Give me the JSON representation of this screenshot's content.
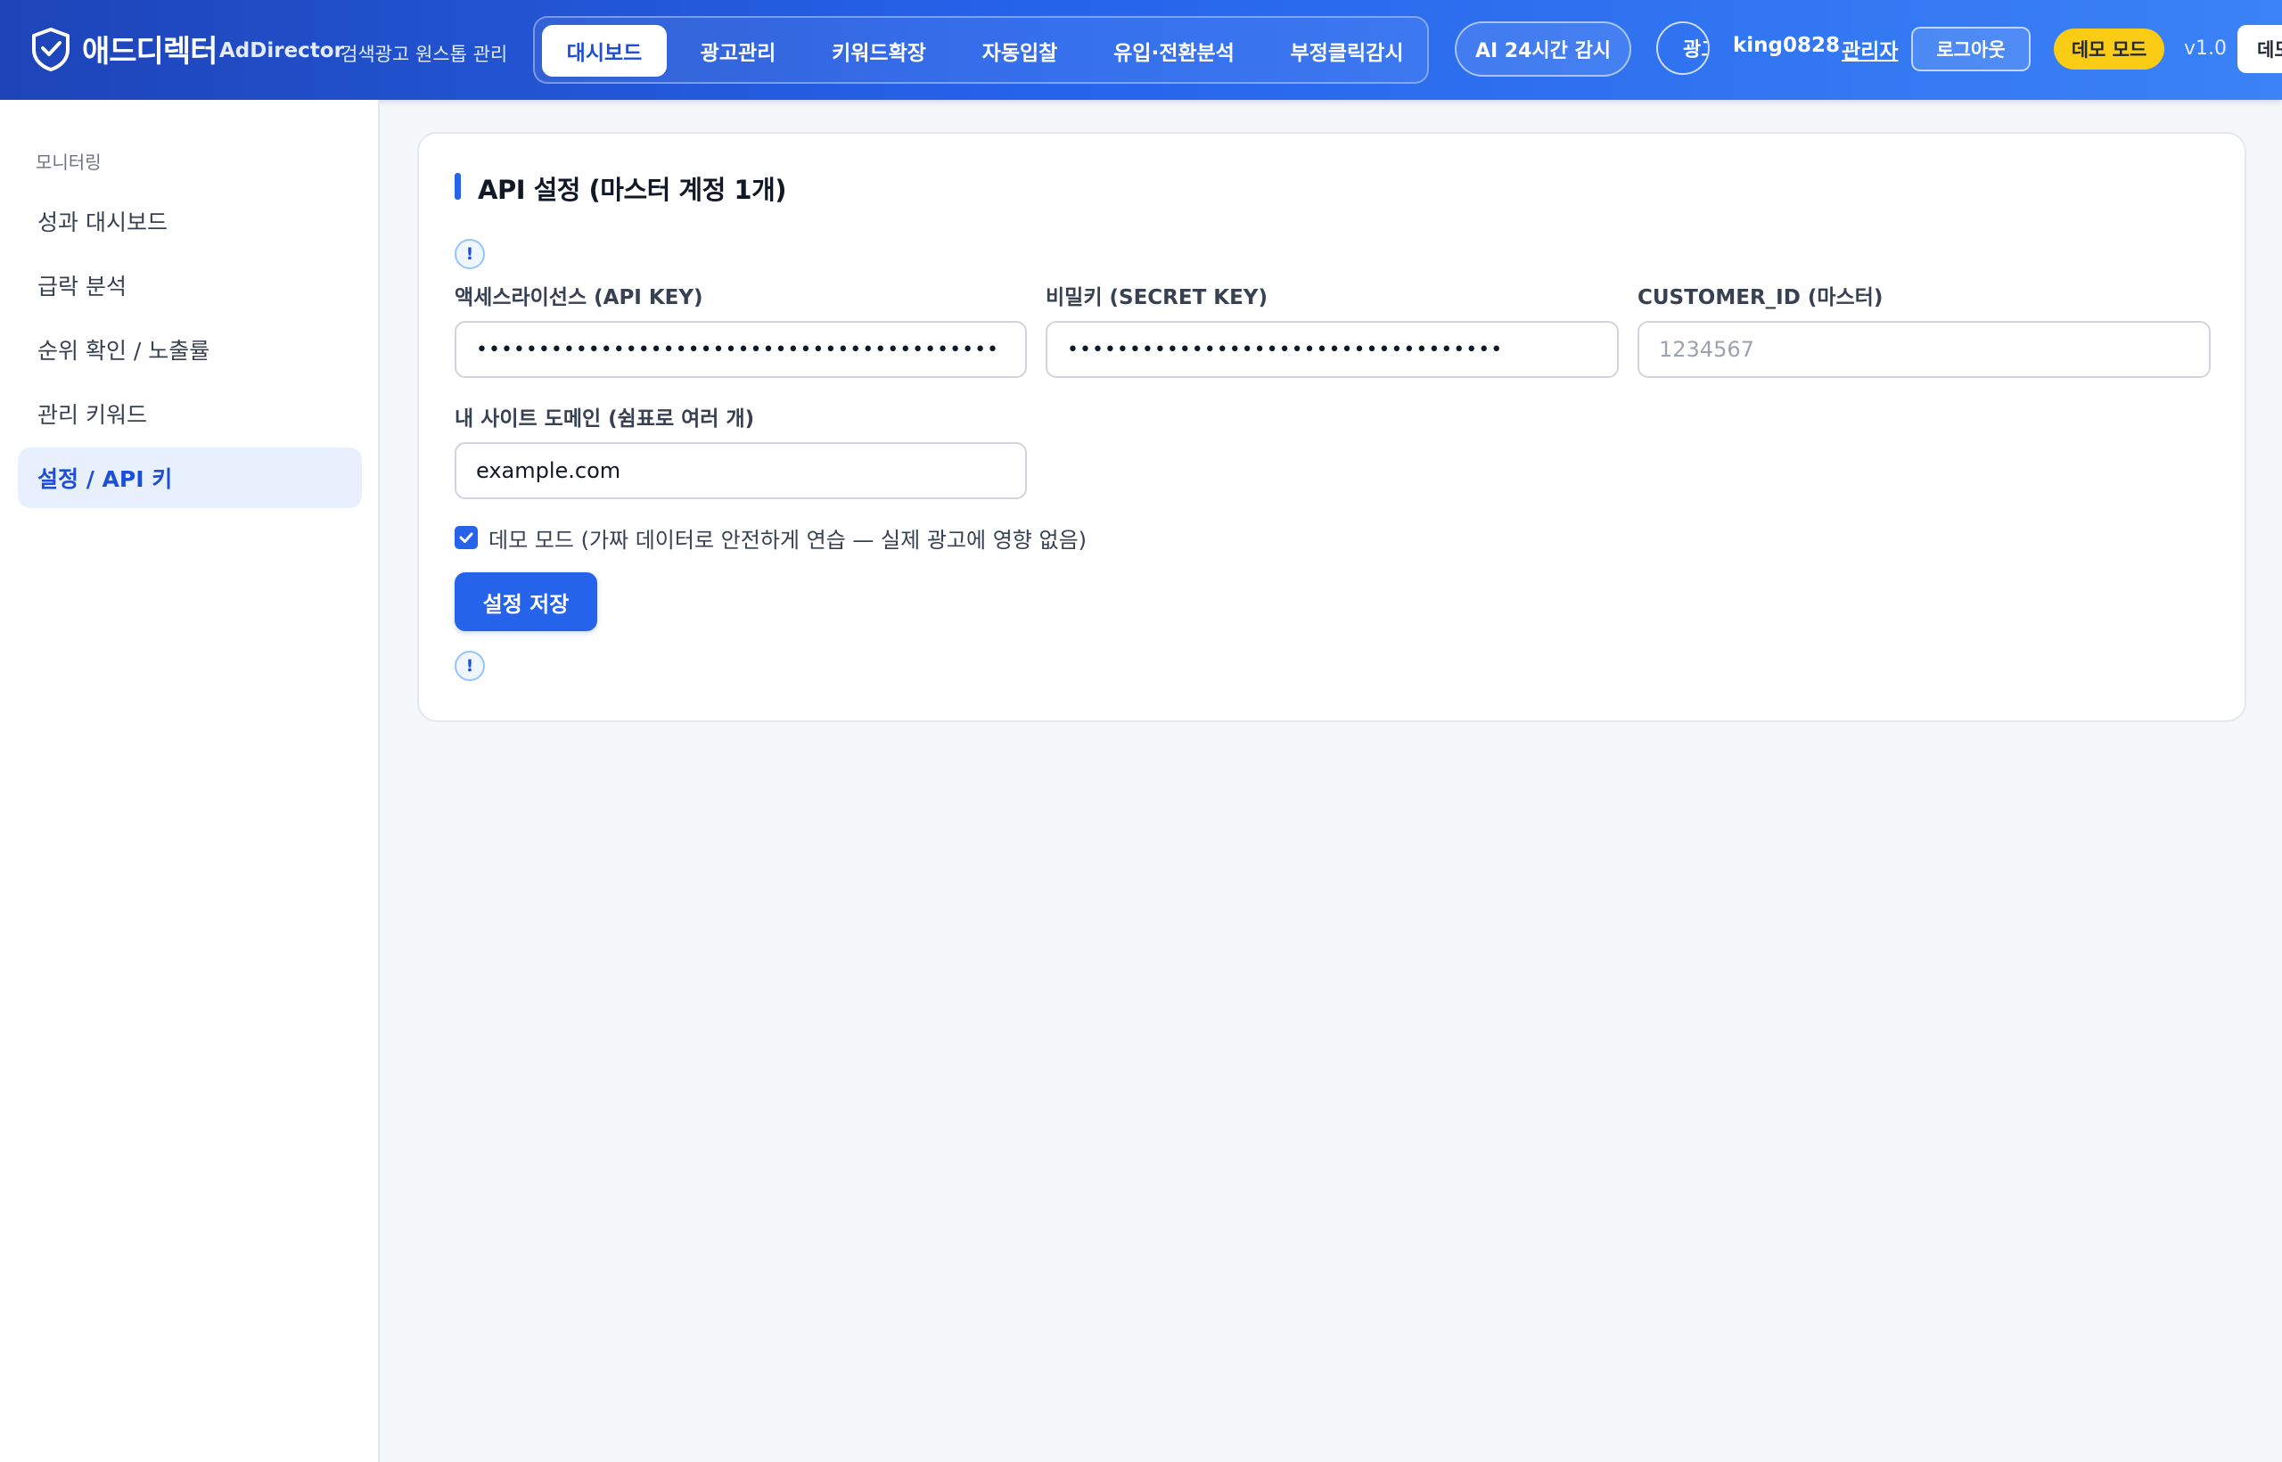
{
  "header": {
    "brand_ko": "애드디렉터",
    "brand_en": "AdDirector",
    "brand_sub": "검색광고 원스톱 관리",
    "nav": [
      {
        "label": "대시보드",
        "active": true
      },
      {
        "label": "광고관리",
        "active": false
      },
      {
        "label": "키워드확장",
        "active": false
      },
      {
        "label": "자동입찰",
        "active": false
      },
      {
        "label": "유입·전환분석",
        "active": false
      },
      {
        "label": "부정클릭감시",
        "active": false
      }
    ],
    "ai_monitor": "AI 24시간 감시",
    "avatar_text": "광고",
    "username": "king0828",
    "admin_link": "관리자",
    "logout": "로그아웃",
    "demo_badge": "데모 모드",
    "version": "v1.0",
    "cut_button": "데모"
  },
  "sidebar": {
    "section": "모니터링",
    "items": [
      {
        "label": "성과 대시보드",
        "active": false
      },
      {
        "label": "급락 분석",
        "active": false
      },
      {
        "label": "순위 확인 / 노출률",
        "active": false
      },
      {
        "label": "관리 키워드",
        "active": false
      },
      {
        "label": "설정 / API 키",
        "active": true
      }
    ]
  },
  "settings": {
    "title": "API 설정 (마스터 계정 1개)",
    "info_mark": "!",
    "api_key": {
      "label": "액세스라이선스 (API KEY)",
      "value": "••••••••••••••••••••••••••••••••••••••••••"
    },
    "secret_key": {
      "label": "비밀키 (SECRET KEY)",
      "value": "•••••••••••••••••••••••••••••••••••"
    },
    "customer_id": {
      "label": "CUSTOMER_ID (마스터)",
      "value": "",
      "placeholder": "1234567"
    },
    "domain": {
      "label": "내 사이트 도메인 (쉼표로 여러 개)",
      "value": "example.com"
    },
    "demo_mode": {
      "label": "데모 모드 (가짜 데이터로 안전하게 연습 — 실제 광고에 영향 없음)",
      "checked": true
    },
    "save_label": "설정 저장"
  },
  "colors": {
    "primary": "#2563eb",
    "header_start": "#1e44b8",
    "header_end": "#3b82f6",
    "demo_badge": "#facc15",
    "active_bg": "#e8f0fe",
    "page_bg": "#f5f7fb"
  },
  "icons": {
    "logo": "shield-check-icon",
    "info": "info-icon",
    "check": "check-icon"
  }
}
